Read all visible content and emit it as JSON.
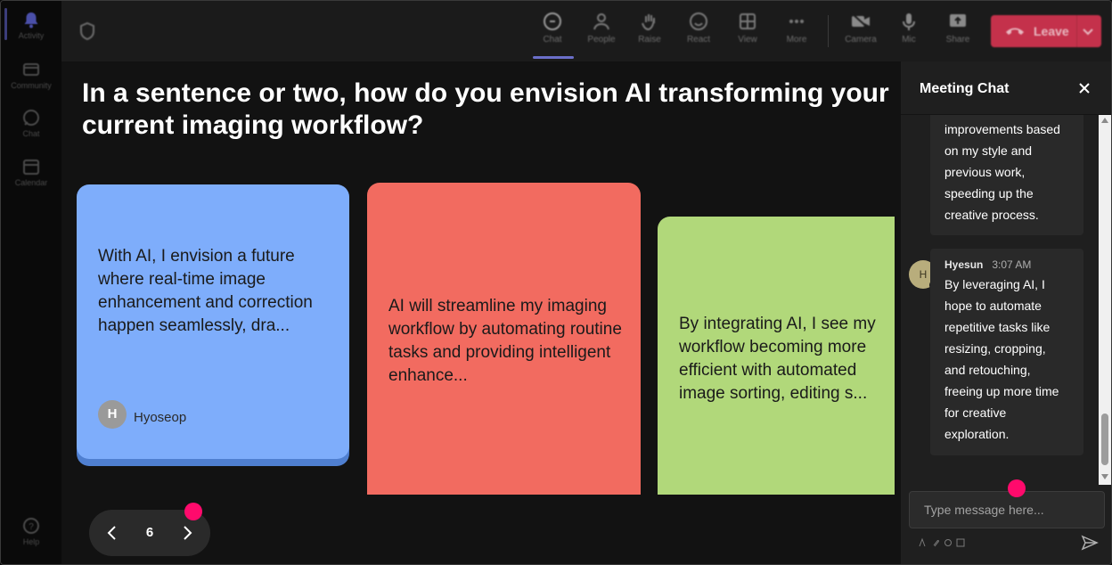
{
  "rail": {
    "items": [
      {
        "label": "Activity",
        "icon": "bell-icon"
      },
      {
        "label": "Community",
        "icon": "community-icon"
      },
      {
        "label": "Chat",
        "icon": "chat-icon"
      },
      {
        "label": "Calendar",
        "icon": "calendar-icon"
      },
      {
        "label": "Help",
        "icon": "help-icon"
      }
    ]
  },
  "toolbar": {
    "chat": "Chat",
    "people": "People",
    "raise": "Raise",
    "react": "React",
    "view": "View",
    "more": "More",
    "camera": "Camera",
    "mic": "Mic",
    "share": "Share",
    "leave": "Leave"
  },
  "stage": {
    "question": "In a sentence or two, how do you envision AI transforming your current imaging workflow?",
    "cards": [
      {
        "text": "With AI, I envision a future where real-time image enhancement and correction happen seamlessly, dra...",
        "author_initial": "H",
        "author": "Hyoseop",
        "color": "#7eadfb"
      },
      {
        "text": "AI will streamline my imaging workflow by automating routine tasks and providing intelligent enhance...",
        "color": "#f26b60"
      },
      {
        "text": "By integrating AI, I see my workflow becoming more efficient with automated image sorting, editing s...",
        "color": "#b1d87a"
      }
    ],
    "page": "6"
  },
  "chat": {
    "title": "Meeting Chat",
    "messages": [
      {
        "text": "improvements based on my style and previous work, speeding up the creative process."
      },
      {
        "initial": "H",
        "sender": "Hyesun",
        "time": "3:07 AM",
        "text": "By leveraging AI, I hope to automate repetitive tasks like resizing, cropping, and retouching, freeing up more time for creative exploration."
      }
    ],
    "placeholder": "Type message here..."
  },
  "colors": {
    "accent": "#7f85f5",
    "leave": "#c4314b",
    "marker": "#ff0a6c"
  }
}
